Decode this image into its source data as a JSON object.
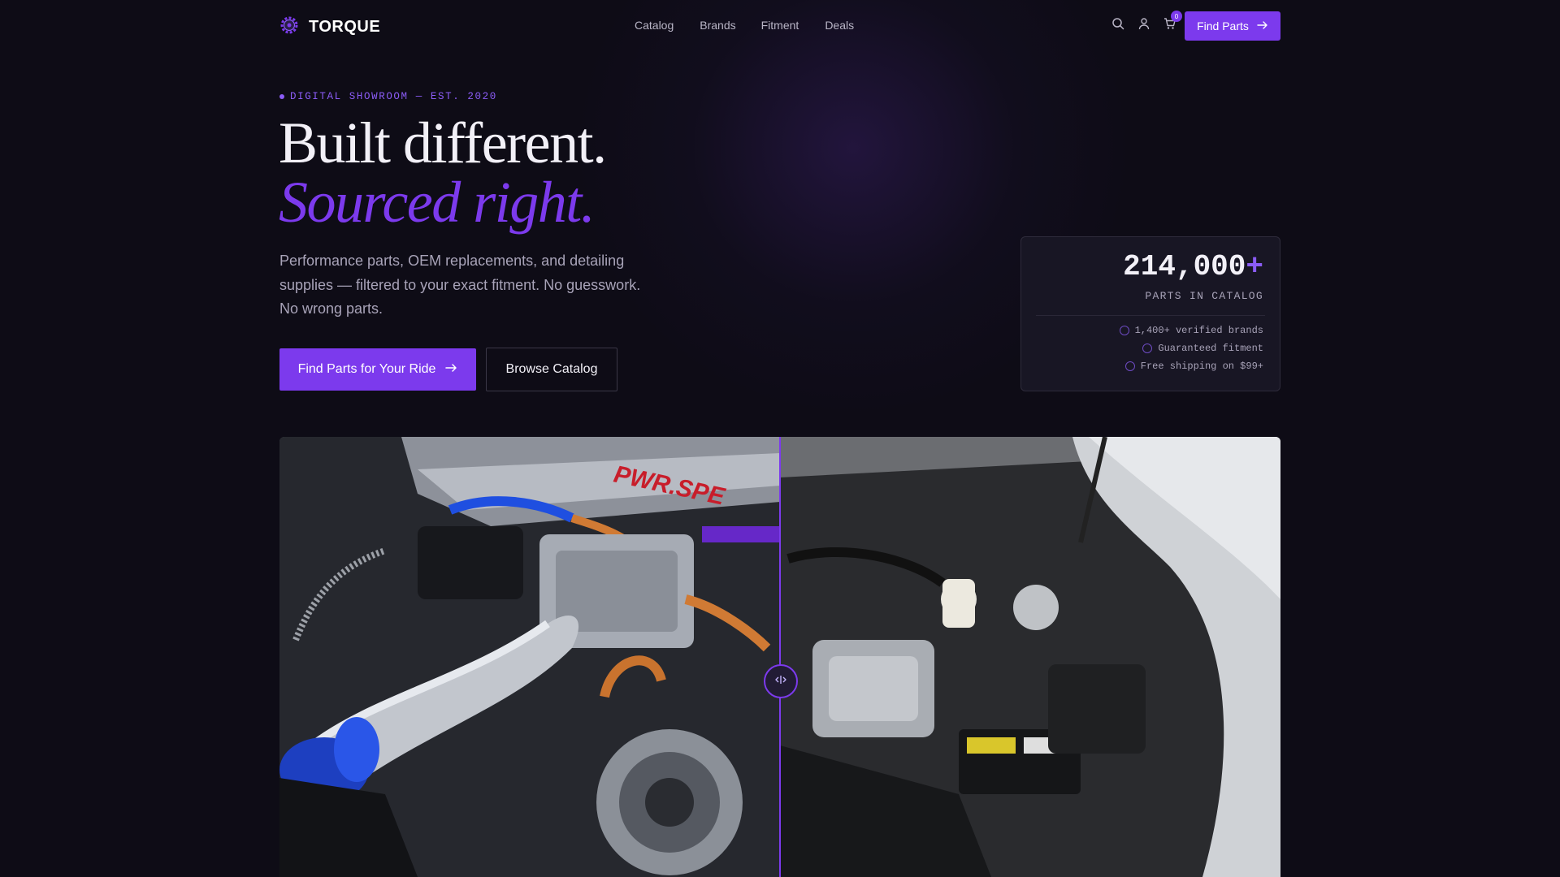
{
  "brand": {
    "name": "TORQUE",
    "logo": "gear-logo-icon"
  },
  "nav": {
    "links": [
      "Catalog",
      "Brands",
      "Fitment",
      "Deals"
    ],
    "icons": [
      "search-icon",
      "user-icon",
      "cart-icon"
    ],
    "cart_count": "0",
    "cta_label": "Find Parts"
  },
  "hero": {
    "eyebrow": "DIGITAL SHOWROOM — EST. 2020",
    "title_line1": "Built different.",
    "title_line2": "Sourced right.",
    "description": "Performance parts, OEM replacements, and detailing supplies — filtered to your exact fitment. No guesswork. No wrong parts.",
    "primary_cta": "Find Parts for Your Ride",
    "secondary_cta": "Browse Catalog"
  },
  "stats": {
    "number": "214,000",
    "plus": "+",
    "label": "PARTS IN CATALOG",
    "items": [
      "1,400+ verified brands",
      "Guaranteed fitment",
      "Free shipping on $99+"
    ]
  },
  "comparison": {
    "left_badge": "PWR.SPE",
    "slider_position": 0.5
  },
  "colors": {
    "accent": "#7c3aed",
    "background": "#0e0c16",
    "card": "#181624"
  }
}
